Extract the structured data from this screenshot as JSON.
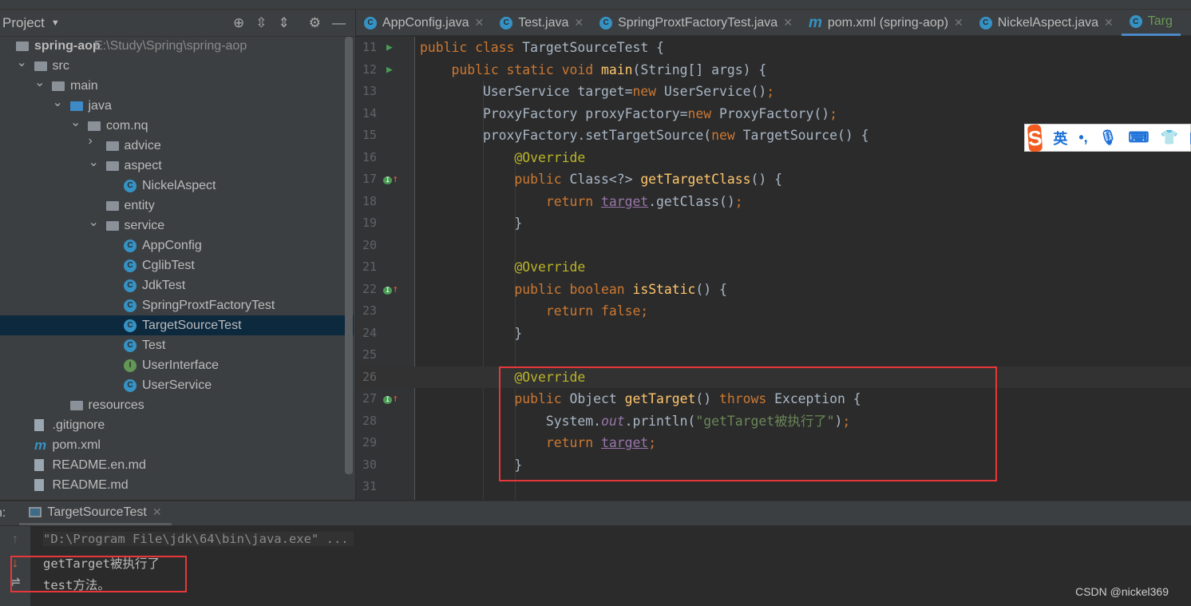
{
  "sidebar": {
    "title": "Project",
    "tools": [
      "locate-icon",
      "expand-all-icon",
      "collapse-all-icon",
      "gear-icon",
      "minimize-icon"
    ],
    "tree": [
      {
        "label": "spring-aop",
        "path": "E:\\Study\\Spring\\spring-aop",
        "level": 0,
        "icon": "module",
        "bold": true
      },
      {
        "label": "src",
        "level": 1,
        "icon": "folder",
        "arrow": "down"
      },
      {
        "label": "main",
        "level": 2,
        "icon": "folder",
        "arrow": "down"
      },
      {
        "label": "java",
        "level": 3,
        "icon": "folder-blue",
        "arrow": "down"
      },
      {
        "label": "com.nq",
        "level": 4,
        "icon": "package",
        "arrow": "down"
      },
      {
        "label": "advice",
        "level": 5,
        "icon": "package",
        "arrow": "right"
      },
      {
        "label": "aspect",
        "level": 5,
        "icon": "package",
        "arrow": "down"
      },
      {
        "label": "NickelAspect",
        "level": 6,
        "icon": "class"
      },
      {
        "label": "entity",
        "level": 5,
        "icon": "package"
      },
      {
        "label": "service",
        "level": 5,
        "icon": "package",
        "arrow": "down"
      },
      {
        "label": "AppConfig",
        "level": 6,
        "icon": "class"
      },
      {
        "label": "CglibTest",
        "level": 6,
        "icon": "class-run"
      },
      {
        "label": "JdkTest",
        "level": 6,
        "icon": "class-run"
      },
      {
        "label": "SpringProxtFactoryTest",
        "level": 6,
        "icon": "class-run"
      },
      {
        "label": "TargetSourceTest",
        "level": 6,
        "icon": "class-run",
        "selected": true
      },
      {
        "label": "Test",
        "level": 6,
        "icon": "class-run"
      },
      {
        "label": "UserInterface",
        "level": 6,
        "icon": "interface"
      },
      {
        "label": "UserService",
        "level": 6,
        "icon": "class"
      },
      {
        "label": "resources",
        "level": 3,
        "icon": "folder"
      },
      {
        "label": ".gitignore",
        "level": 1,
        "icon": "file"
      },
      {
        "label": "pom.xml",
        "level": 1,
        "icon": "maven"
      },
      {
        "label": "README.en.md",
        "level": 1,
        "icon": "md"
      },
      {
        "label": "README.md",
        "level": 1,
        "icon": "md"
      }
    ]
  },
  "tabs": [
    {
      "label": "AppConfig.java",
      "icon": "class"
    },
    {
      "label": "Test.java",
      "icon": "class-run"
    },
    {
      "label": "SpringProxtFactoryTest.java",
      "icon": "class-run"
    },
    {
      "label": "pom.xml (spring-aop)",
      "icon": "maven"
    },
    {
      "label": "NickelAspect.java",
      "icon": "class"
    },
    {
      "label": "Targ",
      "icon": "class-run",
      "active": true
    }
  ],
  "editor": {
    "lines": [
      {
        "n": "11",
        "mark": "run",
        "tokens": [
          [
            "kw",
            "public class "
          ],
          [
            "",
            "TargetSourceTest {"
          ]
        ]
      },
      {
        "n": "12",
        "mark": "run",
        "tokens": [
          [
            "",
            "    "
          ],
          [
            "kw",
            "public static void "
          ],
          [
            "fn",
            "main"
          ],
          [
            "",
            "(String[] args) {"
          ]
        ]
      },
      {
        "n": "13",
        "tokens": [
          [
            "",
            "        UserService target="
          ],
          [
            "kw",
            "new "
          ],
          [
            "",
            "UserService()"
          ],
          [
            "kw",
            ";"
          ]
        ]
      },
      {
        "n": "14",
        "tokens": [
          [
            "",
            "        ProxyFactory proxyFactory="
          ],
          [
            "kw",
            "new "
          ],
          [
            "",
            "ProxyFactory()"
          ],
          [
            "kw",
            ";"
          ]
        ]
      },
      {
        "n": "15",
        "tokens": [
          [
            "",
            "        proxyFactory.setTargetSource("
          ],
          [
            "kw",
            "new "
          ],
          [
            "",
            "TargetSource() {"
          ]
        ]
      },
      {
        "n": "16",
        "tokens": [
          [
            "",
            "            "
          ],
          [
            "an",
            "@Override"
          ]
        ]
      },
      {
        "n": "17",
        "mark": "override",
        "tokens": [
          [
            "",
            "            "
          ],
          [
            "kw",
            "public "
          ],
          [
            "",
            "Class<?> "
          ],
          [
            "fn",
            "getTargetClass"
          ],
          [
            "",
            "() {"
          ]
        ]
      },
      {
        "n": "18",
        "tokens": [
          [
            "",
            "                "
          ],
          [
            "kw",
            "return "
          ],
          [
            "fd ul",
            "target"
          ],
          [
            "",
            ".getClass()"
          ],
          [
            "kw",
            ";"
          ]
        ]
      },
      {
        "n": "19",
        "tokens": [
          [
            "",
            "            }"
          ]
        ]
      },
      {
        "n": "20",
        "tokens": []
      },
      {
        "n": "21",
        "tokens": [
          [
            "",
            "            "
          ],
          [
            "an",
            "@Override"
          ]
        ]
      },
      {
        "n": "22",
        "mark": "override",
        "tokens": [
          [
            "",
            "            "
          ],
          [
            "kw",
            "public boolean "
          ],
          [
            "fn",
            "isStatic"
          ],
          [
            "",
            "() {"
          ]
        ]
      },
      {
        "n": "23",
        "tokens": [
          [
            "",
            "                "
          ],
          [
            "kw",
            "return false;"
          ]
        ]
      },
      {
        "n": "24",
        "tokens": [
          [
            "",
            "            }"
          ]
        ]
      },
      {
        "n": "25",
        "tokens": []
      },
      {
        "n": "26",
        "current": true,
        "tokens": [
          [
            "",
            "            "
          ],
          [
            "an",
            "@Override"
          ]
        ]
      },
      {
        "n": "27",
        "mark": "override",
        "tokens": [
          [
            "",
            "            "
          ],
          [
            "kw",
            "public "
          ],
          [
            "",
            "Object "
          ],
          [
            "fn",
            "getTarget"
          ],
          [
            "",
            "() "
          ],
          [
            "kw",
            "throws "
          ],
          [
            "",
            "Exception {"
          ]
        ]
      },
      {
        "n": "28",
        "tokens": [
          [
            "",
            "                System."
          ],
          [
            "fd it",
            "out"
          ],
          [
            "",
            ".println("
          ],
          [
            "st",
            "\"getTarget被执行了\""
          ],
          [
            "",
            ")"
          ],
          [
            "kw",
            ";"
          ]
        ]
      },
      {
        "n": "29",
        "tokens": [
          [
            "",
            "                "
          ],
          [
            "kw",
            "return "
          ],
          [
            "fd ul",
            "target"
          ],
          [
            "kw",
            ";"
          ]
        ]
      },
      {
        "n": "30",
        "tokens": [
          [
            "",
            "            }"
          ]
        ]
      },
      {
        "n": "31",
        "tokens": []
      }
    ]
  },
  "ime": {
    "logo": "S",
    "mode": "英",
    "punct": "•,",
    "icons": [
      "microphone-icon",
      "keyboard-icon",
      "skin-icon",
      "grid-icon"
    ]
  },
  "run": {
    "prefix": "n:",
    "tab": "TargetSourceTest",
    "output": [
      "\"D:\\Program File\\jdk\\64\\bin\\java.exe\" ...",
      "getTarget被执行了",
      "test方法。"
    ]
  },
  "watermark": "CSDN @nickel369",
  "colors": {
    "highlight_box": "#e8373a",
    "keyword": "#cc7832",
    "annotation": "#bbb529",
    "method": "#ffc66d",
    "string": "#6a8759",
    "field": "#9876aa"
  }
}
